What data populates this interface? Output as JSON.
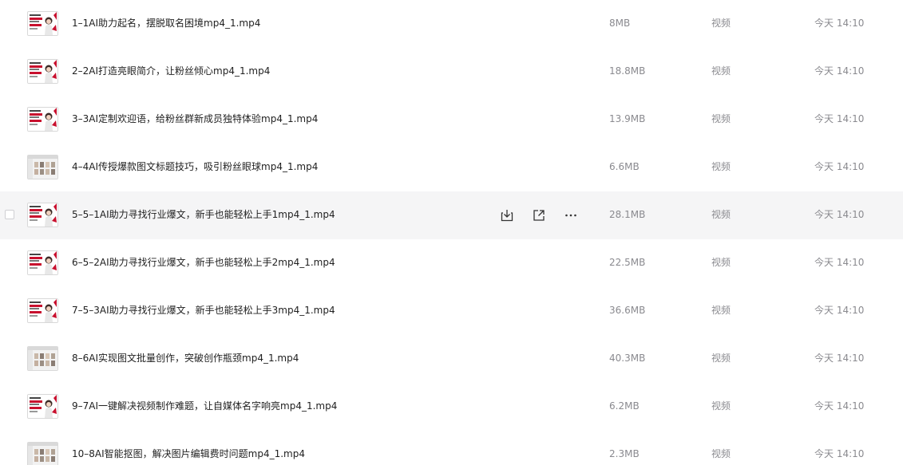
{
  "files": [
    {
      "name": "1–1AI助力起名，摆脱取名困境mp4_1.mp4",
      "size": "8MB",
      "type": "视频",
      "time": "今天 14:10",
      "thumb": "portrait"
    },
    {
      "name": "2–2AI打造亮眼简介，让粉丝倾心mp4_1.mp4",
      "size": "18.8MB",
      "type": "视频",
      "time": "今天 14:10",
      "thumb": "portrait"
    },
    {
      "name": "3–3AI定制欢迎语，给粉丝群新成员独特体验mp4_1.mp4",
      "size": "13.9MB",
      "type": "视频",
      "time": "今天 14:10",
      "thumb": "portrait"
    },
    {
      "name": "4–4AI传授爆款图文标题技巧，吸引粉丝眼球mp4_1.mp4",
      "size": "6.6MB",
      "type": "视频",
      "time": "今天 14:10",
      "thumb": "grid"
    },
    {
      "name": "5–5–1AI助力寻找行业爆文，新手也能轻松上手1mp4_1.mp4",
      "size": "28.1MB",
      "type": "视频",
      "time": "今天 14:10",
      "thumb": "portrait",
      "hovered": true
    },
    {
      "name": "6–5–2AI助力寻找行业爆文，新手也能轻松上手2mp4_1.mp4",
      "size": "22.5MB",
      "type": "视频",
      "time": "今天 14:10",
      "thumb": "portrait"
    },
    {
      "name": "7–5–3AI助力寻找行业爆文，新手也能轻松上手3mp4_1.mp4",
      "size": "36.6MB",
      "type": "视频",
      "time": "今天 14:10",
      "thumb": "portrait"
    },
    {
      "name": "8–6AI实现图文批量创作，突破创作瓶颈mp4_1.mp4",
      "size": "40.3MB",
      "type": "视频",
      "time": "今天 14:10",
      "thumb": "grid"
    },
    {
      "name": "9–7AI一键解决视频制作难题，让自媒体名字响亮mp4_1.mp4",
      "size": "6.2MB",
      "type": "视频",
      "time": "今天 14:10",
      "thumb": "portrait"
    },
    {
      "name": "10–8AI智能抠图，解决图片编辑费时问题mp4_1.mp4",
      "size": "2.3MB",
      "type": "视频",
      "time": "今天 14:10",
      "thumb": "grid"
    }
  ],
  "icons": {
    "download": "download-icon",
    "share": "share-icon",
    "more": "more-icon"
  },
  "colors": {
    "hover_bg": "#f5f5f6",
    "thumb_red": "#c8102e",
    "text_primary": "#1f1f1f",
    "text_secondary": "#8a8a8f"
  }
}
